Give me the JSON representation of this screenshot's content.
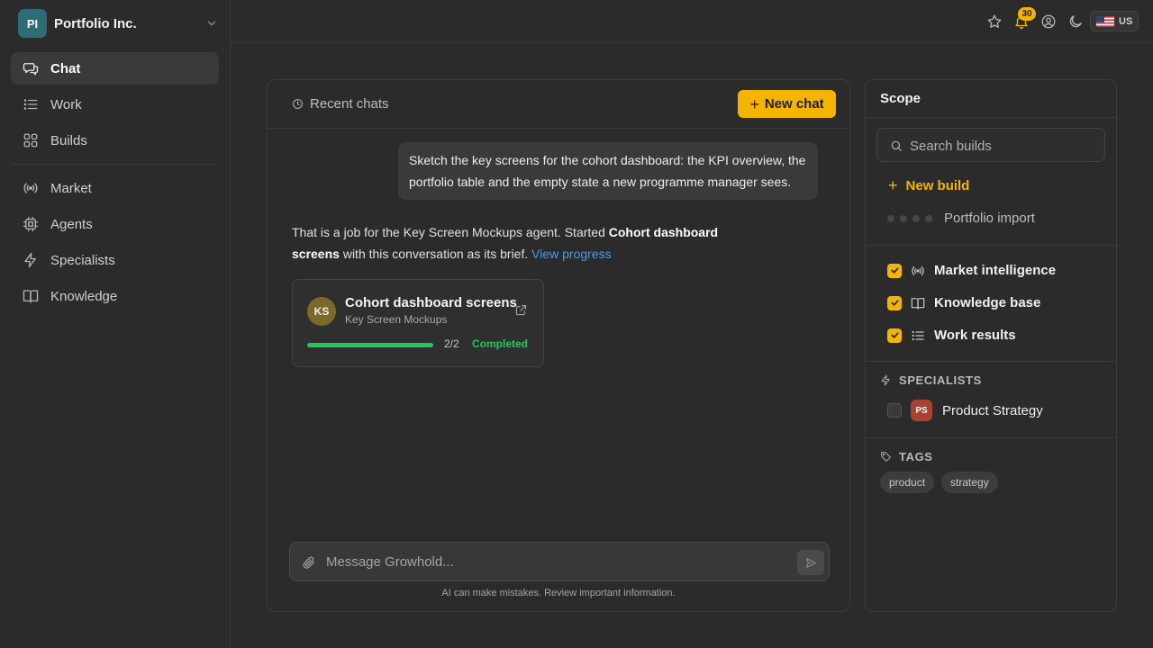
{
  "org": {
    "initials": "PI",
    "name": "Portfolio Inc."
  },
  "nav": {
    "chat": "Chat",
    "work": "Work",
    "builds": "Builds",
    "market": "Market",
    "agents": "Agents",
    "specialists": "Specialists",
    "knowledge": "Knowledge"
  },
  "topbar": {
    "notification_count": "30",
    "locale_code": "US"
  },
  "chat": {
    "recent_label": "Recent chats",
    "new_chat_label": "New chat",
    "user_message": "Sketch the key screens for the cohort dashboard: the KPI overview, the portfolio table and the empty state a new programme manager sees.",
    "assistant": {
      "part1": "That is a job for the Key Screen Mockups agent. Started ",
      "bold": "Cohort dashboard screens",
      "part2": " with this conversation as its brief. ",
      "link": "View progress"
    },
    "build_card": {
      "initials": "KS",
      "title": "Cohort dashboard screens",
      "subtitle": "Key Screen Mockups",
      "progress": 1.0,
      "count": "2/2",
      "status": "Completed"
    },
    "composer_placeholder": "Message Growhold...",
    "disclaimer": "AI can make mistakes. Review important information."
  },
  "scope": {
    "title": "Scope",
    "search_placeholder": "Search builds",
    "new_build_label": "New build",
    "build_item": "Portfolio import",
    "sources": [
      {
        "label": "Market intelligence",
        "checked": true
      },
      {
        "label": "Knowledge base",
        "checked": true
      },
      {
        "label": "Work results",
        "checked": true
      }
    ],
    "specialists_label": "SPECIALISTS",
    "specialist": {
      "initials": "PS",
      "name": "Product Strategy",
      "checked": false
    },
    "tags_label": "TAGS",
    "tags": [
      "product",
      "strategy"
    ]
  },
  "colors": {
    "accent": "#f5b400",
    "success": "#1ec85a",
    "link": "#4f9be0"
  }
}
